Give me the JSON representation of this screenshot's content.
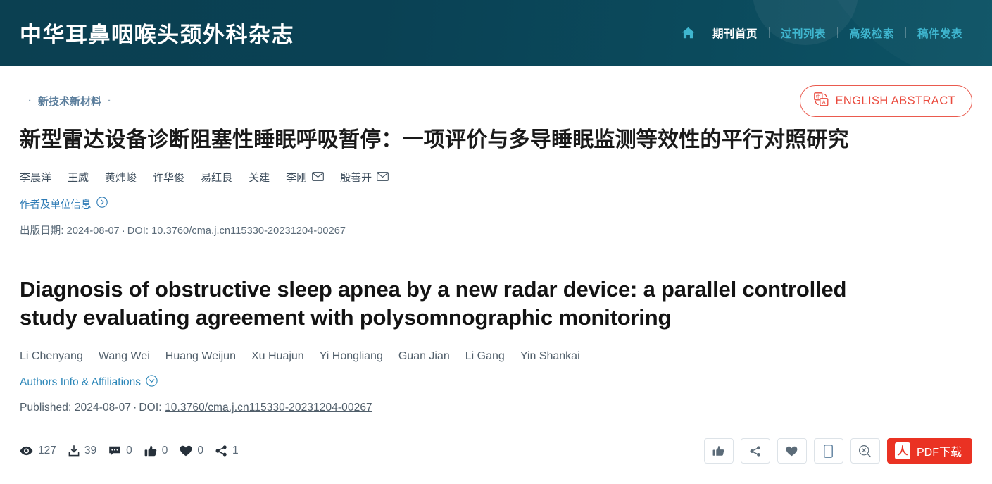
{
  "header": {
    "journal_title": "中华耳鼻咽喉头颈外科杂志",
    "home_icon": "home-icon",
    "nav": [
      {
        "label": "期刊首页",
        "active": true
      },
      {
        "label": "过刊列表",
        "active": false
      },
      {
        "label": "高级检索",
        "active": false
      },
      {
        "label": "稿件发表",
        "active": false
      }
    ]
  },
  "article": {
    "category": "新技术新材料",
    "category_dot": "·",
    "english_abstract_button": {
      "label": "ENGLISH ABSTRACT",
      "icon": "translate-icon",
      "color": "#ea4a3d"
    },
    "cn_title": "新型雷达设备诊断阻塞性睡眠呼吸暂停：一项评价与多导睡眠监测等效性的平行对照研究",
    "cn_authors": [
      {
        "name": "李晨洋",
        "corresponding": false
      },
      {
        "name": "王威",
        "corresponding": false
      },
      {
        "name": "黄炜峻",
        "corresponding": false
      },
      {
        "name": "许华俊",
        "corresponding": false
      },
      {
        "name": "易红良",
        "corresponding": false
      },
      {
        "name": "关建",
        "corresponding": false
      },
      {
        "name": "李刚",
        "corresponding": true
      },
      {
        "name": "殷善开",
        "corresponding": true
      }
    ],
    "cn_affiliations_link": "作者及单位信息",
    "cn_affiliations_icon": "chevron-right-circle-icon",
    "cn_pub_label": "出版日期:",
    "cn_pub_date": "2024-08-07",
    "cn_doi_label": "DOI:",
    "doi": "10.3760/cma.j.cn115330-20231204-00267",
    "en_title": "Diagnosis of obstructive sleep apnea by a new radar device: a parallel controlled study evaluating agreement with polysomnographic monitoring",
    "en_authors": [
      "Li Chenyang",
      "Wang Wei",
      "Huang Weijun",
      "Xu Huajun",
      "Yi Hongliang",
      "Guan Jian",
      "Li Gang",
      "Yin Shankai"
    ],
    "en_affiliations_link": "Authors Info & Affiliations",
    "en_affiliations_icon": "chevron-down-circle-icon",
    "en_pub_label": "Published:",
    "en_pub_date": "2024-08-07",
    "en_doi_label": "DOI:"
  },
  "metrics": [
    {
      "icon": "eye-icon",
      "label": "views",
      "value": "127"
    },
    {
      "icon": "download-icon",
      "label": "downloads",
      "value": "39"
    },
    {
      "icon": "comment-icon",
      "label": "comments",
      "value": "0"
    },
    {
      "icon": "thumbs-up-icon",
      "label": "likes",
      "value": "0"
    },
    {
      "icon": "heart-icon",
      "label": "favorites",
      "value": "0"
    },
    {
      "icon": "share-icon",
      "label": "shares",
      "value": "1"
    }
  ],
  "actions": {
    "buttons": [
      {
        "icon": "thumbs-up-icon",
        "name": "like-button"
      },
      {
        "icon": "share-icon",
        "name": "share-button"
      },
      {
        "icon": "heart-icon",
        "name": "favorite-button"
      },
      {
        "icon": "mobile-icon",
        "name": "mobile-view-button"
      },
      {
        "icon": "search-cancel-icon",
        "name": "clear-search-button"
      }
    ],
    "pdf": {
      "label": "PDF下载",
      "icon": "pdf-icon",
      "color": "#ea3223"
    }
  }
}
